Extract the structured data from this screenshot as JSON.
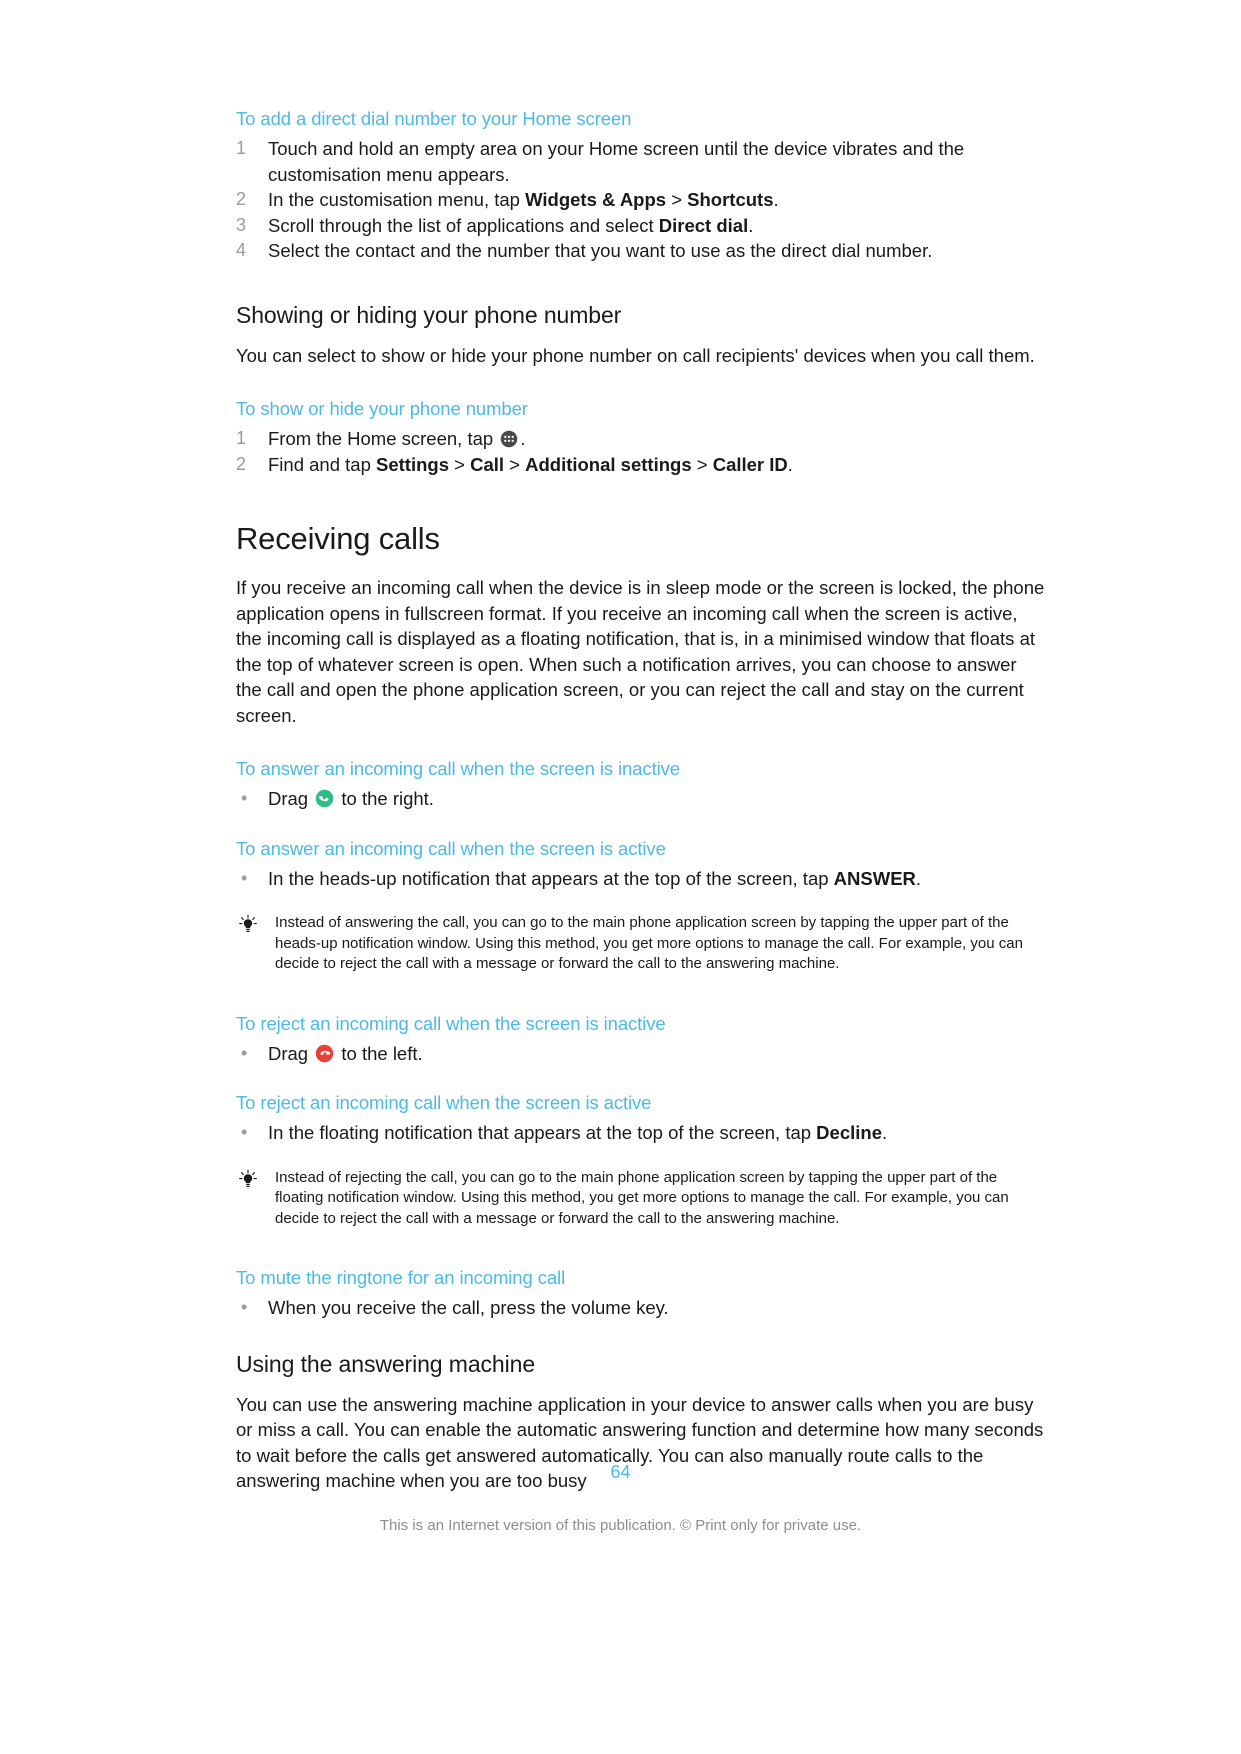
{
  "document": {
    "page_number": "64",
    "footer_note": "This is an Internet version of this publication. © Print only for private use.",
    "accent_color": "#4cb9e8",
    "answer_icon_color": "#2ebd82",
    "reject_icon_color": "#e8413c",
    "appdrawer_icon_color": "#4a4a4a"
  },
  "procedures": {
    "direct_dial": {
      "title": "To add a direct dial number to your Home screen",
      "steps": [
        {
          "num": "1",
          "parts": [
            {
              "t": "Touch and hold an empty area on your Home screen until the device vibrates and the customisation menu appears.",
              "b": false
            }
          ]
        },
        {
          "num": "2",
          "parts": [
            {
              "t": "In the customisation menu, tap ",
              "b": false
            },
            {
              "t": "Widgets & Apps",
              "b": true
            },
            {
              "t": " > ",
              "b": false
            },
            {
              "t": "Shortcuts",
              "b": true
            },
            {
              "t": ".",
              "b": false
            }
          ]
        },
        {
          "num": "3",
          "parts": [
            {
              "t": "Scroll through the list of applications and select ",
              "b": false
            },
            {
              "t": "Direct dial",
              "b": true
            },
            {
              "t": ".",
              "b": false
            }
          ]
        },
        {
          "num": "4",
          "parts": [
            {
              "t": "Select the contact and the number that you want to use as the direct dial number.",
              "b": false
            }
          ]
        }
      ]
    },
    "show_hide_number": {
      "title": "To show or hide your phone number",
      "step1_before": "From the Home screen, tap ",
      "step1_icon": "app-drawer-icon",
      "step1_after": ".",
      "step2_parts": [
        {
          "t": "Find and tap ",
          "b": false
        },
        {
          "t": "Settings",
          "b": true
        },
        {
          "t": " > ",
          "b": false
        },
        {
          "t": "Call",
          "b": true
        },
        {
          "t": " > ",
          "b": false
        },
        {
          "t": "Additional settings",
          "b": true
        },
        {
          "t": " > ",
          "b": false
        },
        {
          "t": "Caller ID",
          "b": true
        },
        {
          "t": ".",
          "b": false
        }
      ],
      "nums": {
        "one": "1",
        "two": "2"
      }
    },
    "answer_inactive": {
      "title": "To answer an incoming call when the screen is inactive",
      "bullet": "•",
      "before": "Drag ",
      "icon": "answer-call-icon",
      "after": " to the right."
    },
    "answer_active": {
      "title": "To answer an incoming call when the screen is active",
      "bullet": "•",
      "parts": [
        {
          "t": "In the heads-up notification that appears at the top of the screen, tap ",
          "b": false
        },
        {
          "t": "ANSWER",
          "b": true
        },
        {
          "t": ".",
          "b": false
        }
      ]
    },
    "reject_inactive": {
      "title": "To reject an incoming call when the screen is inactive",
      "bullet": "•",
      "before": "Drag ",
      "icon": "reject-call-icon",
      "after": " to the left."
    },
    "reject_active": {
      "title": "To reject an incoming call when the screen is active",
      "bullet": "•",
      "parts": [
        {
          "t": "In the floating notification that appears at the top of the screen, tap ",
          "b": false
        },
        {
          "t": "Decline",
          "b": true
        },
        {
          "t": ".",
          "b": false
        }
      ]
    },
    "mute_ringtone": {
      "title": "To mute the ringtone for an incoming call",
      "bullet": "•",
      "text": "When you receive the call, press the volume key."
    }
  },
  "sections": {
    "showing_hiding": {
      "heading": "Showing or hiding your phone number",
      "body": "You can select to show or hide your phone number on call recipients' devices when you call them."
    },
    "receiving_calls": {
      "heading": "Receiving calls",
      "body": "If you receive an incoming call when the device is in sleep mode or the screen is locked, the phone application opens in fullscreen format. If you receive an incoming call when the screen is active, the incoming call is displayed as a floating notification, that is, in a minimised window that floats at the top of whatever screen is open. When such a notification arrives, you can choose to answer the call and open the phone application screen, or you can reject the call and stay on the current screen."
    },
    "answering_machine": {
      "heading": "Using the answering machine",
      "body": "You can use the answering machine application in your device to answer calls when you are busy or miss a call. You can enable the automatic answering function and determine how many seconds to wait before the calls get answered automatically. You can also manually route calls to the answering machine when you are too busy"
    }
  },
  "tips": {
    "answer_tip": "Instead of answering the call, you can go to the main phone application screen by tapping the upper part of the heads-up notification window. Using this method, you get more options to manage the call. For example, you can decide to reject the call with a message or forward the call to the answering machine.",
    "reject_tip": "Instead of rejecting the call, you can go to the main phone application screen by tapping the upper part of the floating notification window. Using this method, you get more options to manage the call. For example, you can decide to reject the call with a message or forward the call to the answering machine."
  }
}
